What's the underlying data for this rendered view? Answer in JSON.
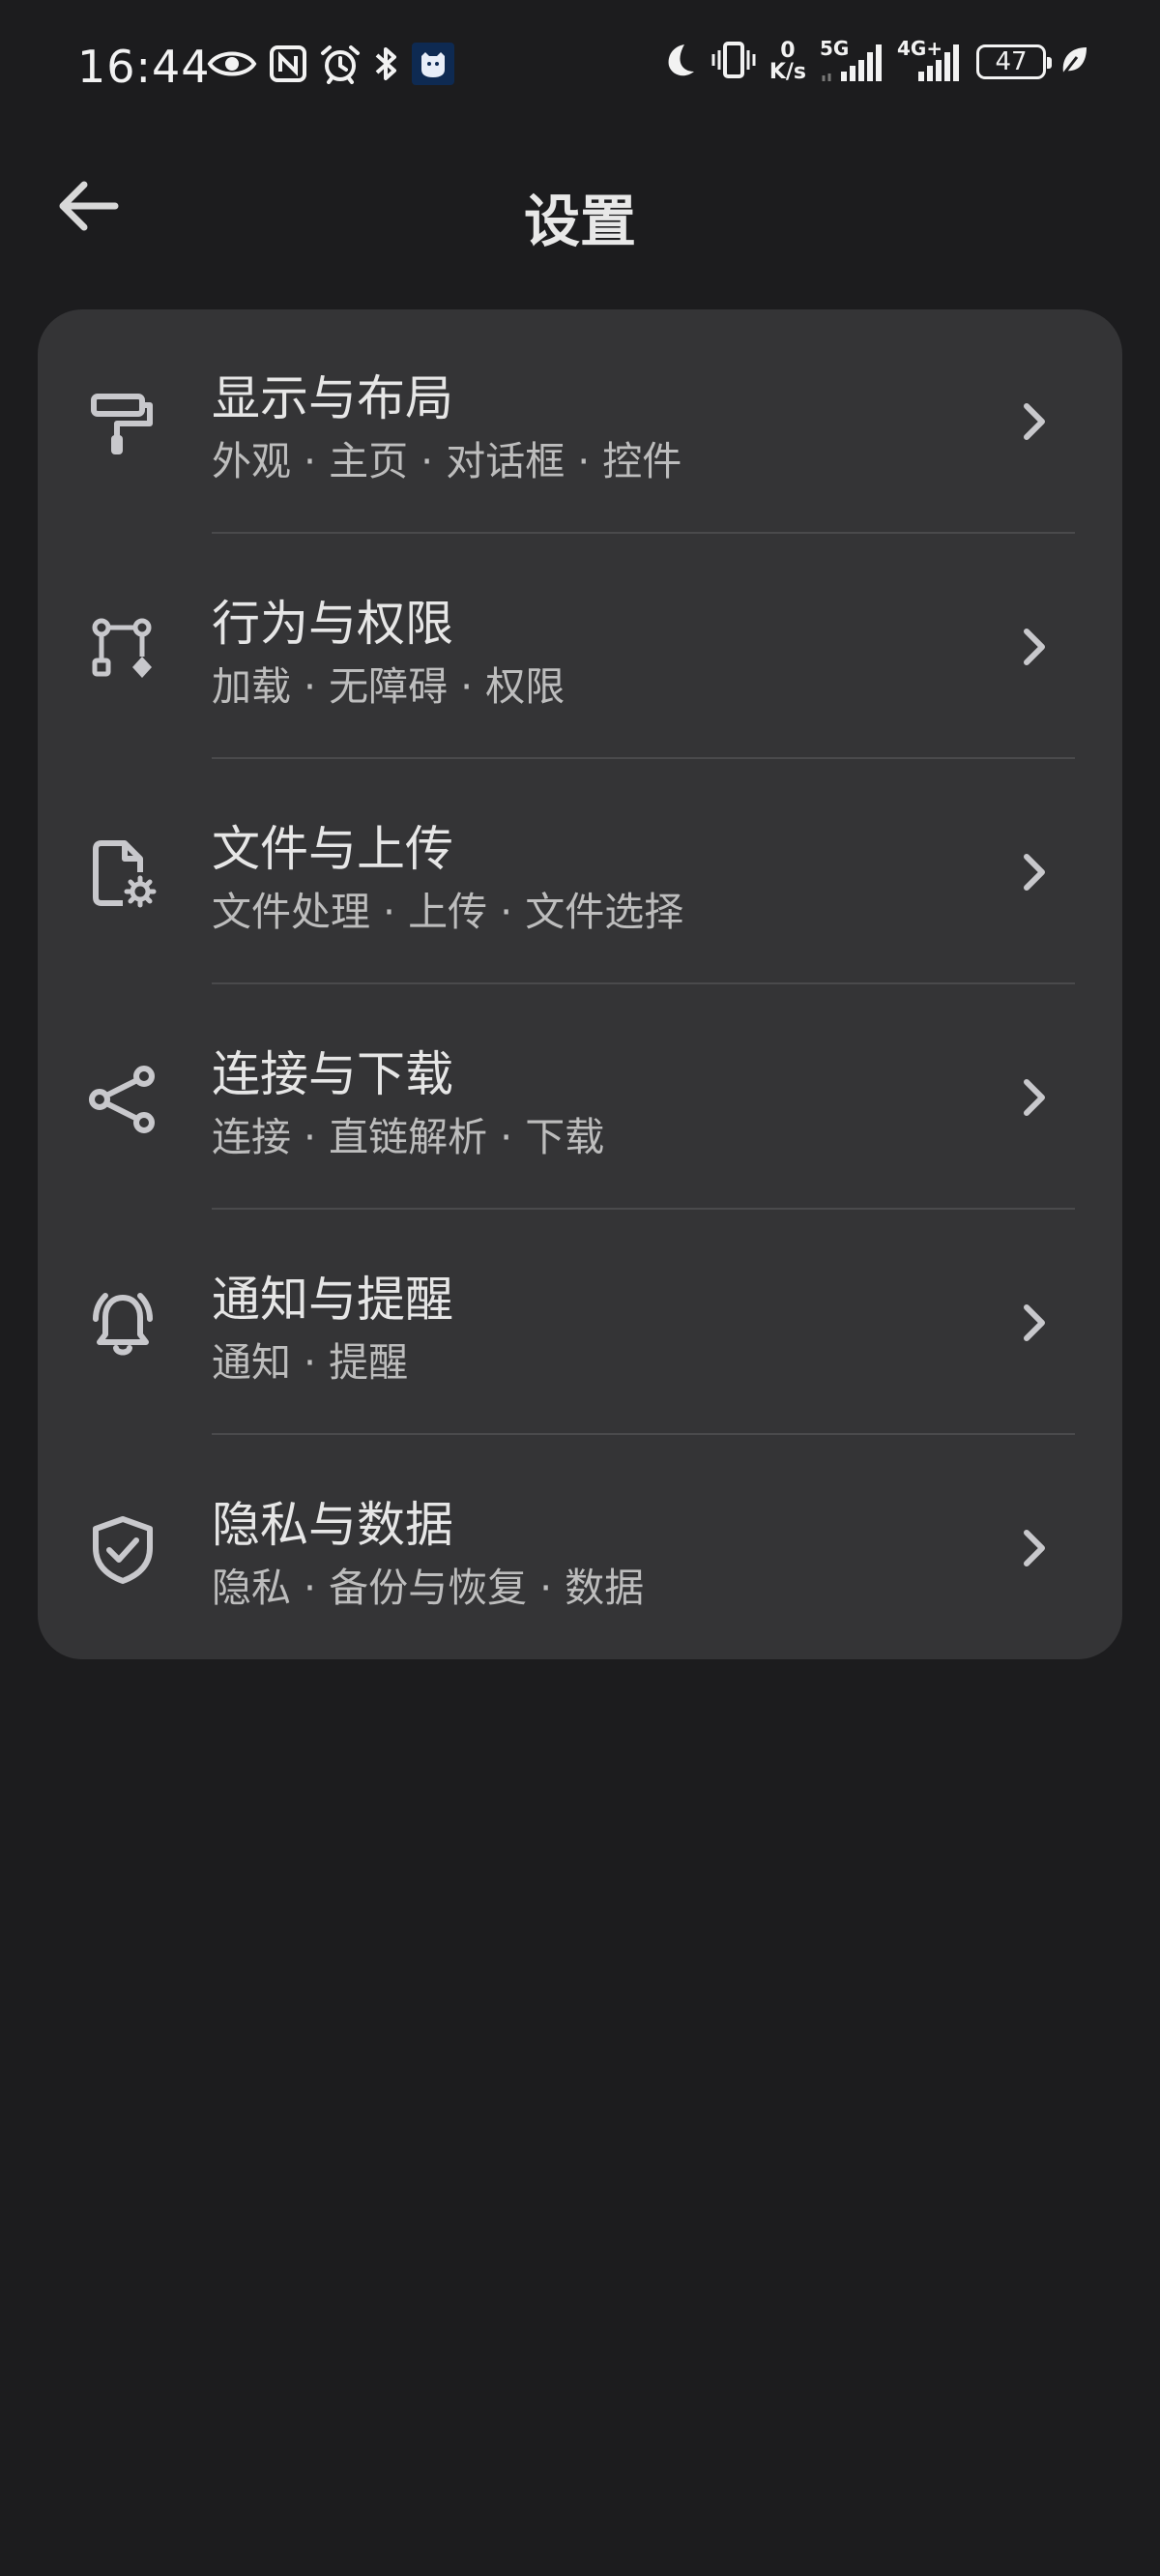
{
  "status_bar": {
    "time": "16:44",
    "icons_left": [
      "eye-icon",
      "nfc-icon",
      "alarm-icon",
      "bluetooth-icon",
      "app-notification-icon"
    ],
    "icons_right": [
      "moon-icon",
      "vibrate-icon"
    ],
    "speed_value": "0",
    "speed_unit": "K/s",
    "net1_label": "5G",
    "net2_label": "4G+",
    "battery": "47"
  },
  "header": {
    "title": "设置",
    "back_icon": "arrow-left-icon"
  },
  "settings": [
    {
      "title": "显示与布局",
      "subtitle": "外观 · 主页 · 对话框 · 控件",
      "icon": "paint-roller-icon"
    },
    {
      "title": "行为与权限",
      "subtitle": "加载 · 无障碍 · 权限",
      "icon": "workflow-icon"
    },
    {
      "title": "文件与上传",
      "subtitle": "文件处理 · 上传 · 文件选择",
      "icon": "file-settings-icon"
    },
    {
      "title": "连接与下载",
      "subtitle": "连接 · 直链解析 · 下载",
      "icon": "share-nodes-icon"
    },
    {
      "title": "通知与提醒",
      "subtitle": "通知 · 提醒",
      "icon": "bell-ring-icon"
    },
    {
      "title": "隐私与数据",
      "subtitle": "隐私 · 备份与恢复 · 数据",
      "icon": "shield-check-icon"
    }
  ],
  "colors": {
    "background": "#1c1c1e",
    "card": "#343436",
    "text_primary": "#e6e6e6",
    "text_secondary": "#bdbdbd",
    "icon": "#c8c8cc",
    "divider": "#4a4a4c"
  }
}
